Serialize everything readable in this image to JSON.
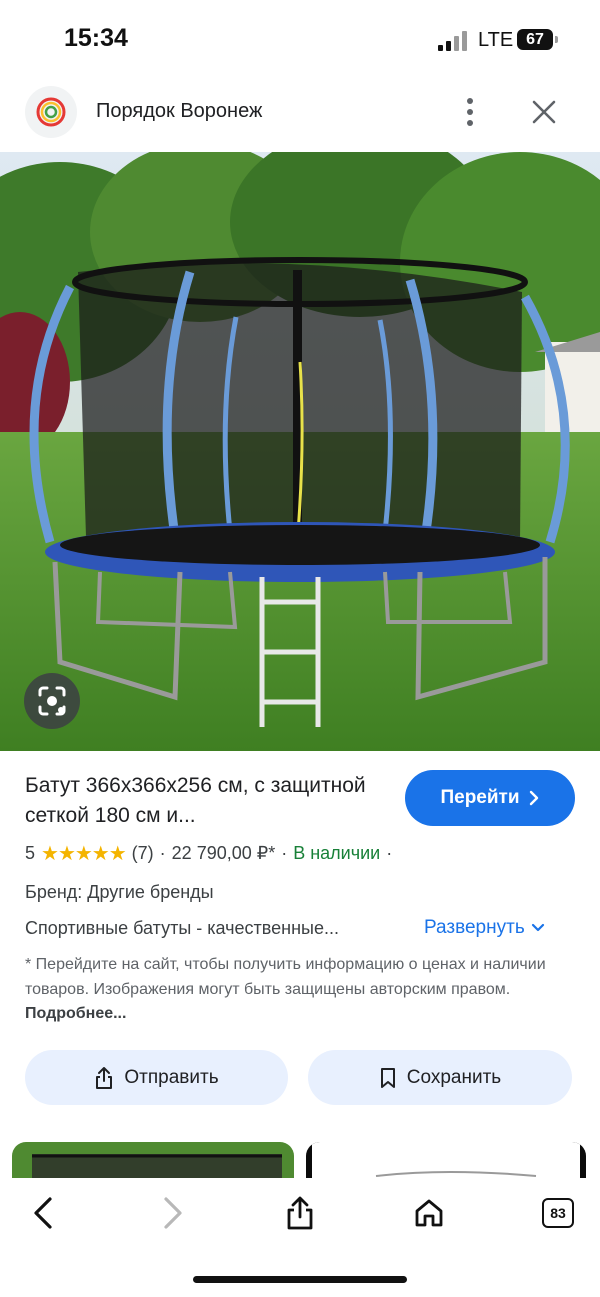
{
  "status_bar": {
    "time": "15:34",
    "network": "LTE",
    "battery": "67"
  },
  "header": {
    "site_title": "Порядок Воронеж"
  },
  "product": {
    "title": "Батут 366x366x256 см, с защитной сеткой 180 см и...",
    "go_label": "Перейти",
    "rating": "5",
    "reviews": "(7)",
    "price": "22 790,00 ₽*",
    "availability": "В наличии",
    "separator": "·",
    "brand": "Бренд: Другие бренды",
    "description": "Спортивные батуты - качественные...",
    "expand_label": "Развернуть",
    "disclaimer": "* Перейдите на сайт, чтобы получить информацию о ценах и наличии товаров. Изображения могут быть защищены авторским правом.",
    "more_label": "Подробнее..."
  },
  "actions": {
    "share_label": "Отправить",
    "save_label": "Сохранить"
  },
  "toolbar": {
    "tabs_count": "83"
  },
  "colors": {
    "accent": "#1a73e8",
    "in_stock": "#188038",
    "star": "#f4b400",
    "pill_bg": "#e8f0fe"
  }
}
